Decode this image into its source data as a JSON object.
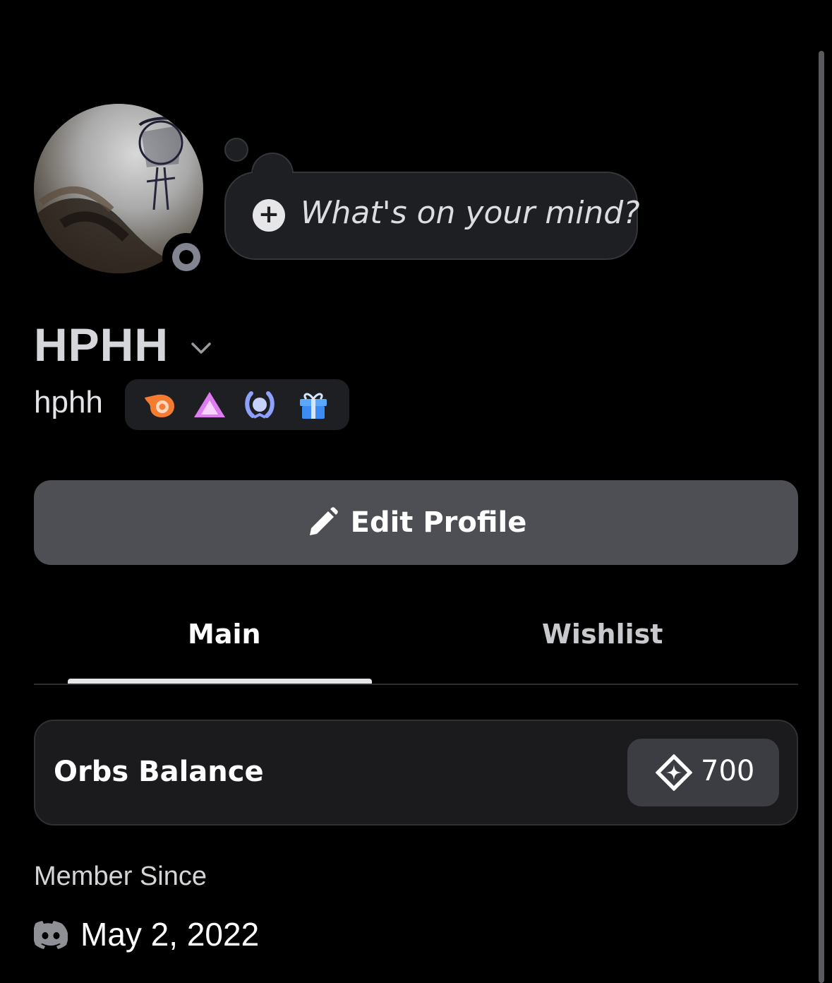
{
  "status": {
    "placeholder": "What's on your mind?",
    "add_icon": "plus-circle-icon"
  },
  "profile": {
    "display_name": "HPHH",
    "username": "hphh",
    "presence": "offline",
    "badges": [
      {
        "name": "hypesquad-balance-badge",
        "color": "#f47b2f"
      },
      {
        "name": "nitro-triangle-badge",
        "color": "#e07cf2"
      },
      {
        "name": "quest-laurel-badge",
        "color": "#8ea1ff"
      },
      {
        "name": "gift-badge",
        "color": "#3d8cf5"
      }
    ]
  },
  "actions": {
    "edit_profile": "Edit Profile"
  },
  "tabs": {
    "main": "Main",
    "wishlist": "Wishlist",
    "active": "Main"
  },
  "orbs": {
    "label": "Orbs Balance",
    "value": "700"
  },
  "member": {
    "title": "Member Since",
    "date": "May 2, 2022"
  },
  "colors": {
    "background": "#000000",
    "button": "#4e4f54",
    "card": "#1b1b1e",
    "bubble": "#1e1f22"
  }
}
